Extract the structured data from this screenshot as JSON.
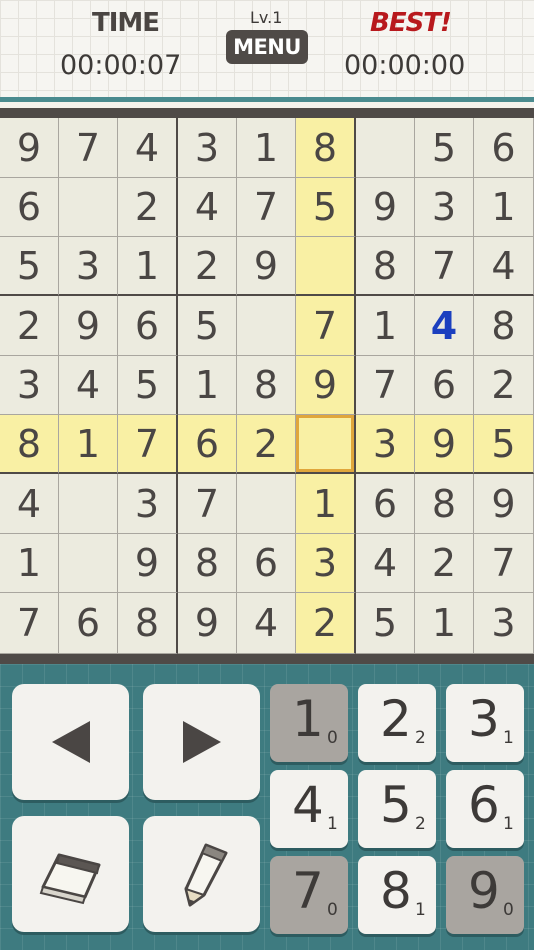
{
  "header": {
    "time_label": "TIME",
    "time_value": "00:00:07",
    "level_label": "Lv.1",
    "menu_label": "MENU",
    "best_label": "BEST!",
    "best_value": "00:00:00"
  },
  "board": {
    "selected": {
      "row": 5,
      "col": 5
    },
    "highlight_color": "#f9f0a4",
    "user_entry_color": "#1b3fbf",
    "rows": [
      [
        "9",
        "7",
        "4",
        "3",
        "1",
        "8",
        "",
        "5",
        "6"
      ],
      [
        "6",
        "",
        "2",
        "4",
        "7",
        "5",
        "9",
        "3",
        "1"
      ],
      [
        "5",
        "3",
        "1",
        "2",
        "9",
        "",
        "8",
        "7",
        "4"
      ],
      [
        "2",
        "9",
        "6",
        "5",
        "",
        "7",
        "1",
        "4",
        "8"
      ],
      [
        "3",
        "4",
        "5",
        "1",
        "8",
        "9",
        "7",
        "6",
        "2"
      ],
      [
        "8",
        "1",
        "7",
        "6",
        "2",
        "",
        "3",
        "9",
        "5"
      ],
      [
        "4",
        "",
        "3",
        "7",
        "",
        "1",
        "6",
        "8",
        "9"
      ],
      [
        "1",
        "",
        "9",
        "8",
        "6",
        "3",
        "4",
        "2",
        "7"
      ],
      [
        "7",
        "6",
        "8",
        "9",
        "4",
        "2",
        "5",
        "1",
        "3"
      ]
    ],
    "user_entries": [
      {
        "row": 3,
        "col": 7
      }
    ]
  },
  "controls": {
    "left_arrow_icon": "left-arrow-icon",
    "right_arrow_icon": "right-arrow-icon",
    "eraser_icon": "eraser-icon",
    "pencil_icon": "pencil-icon",
    "number_buttons": [
      {
        "digit": "1",
        "remaining": "0",
        "used": true
      },
      {
        "digit": "2",
        "remaining": "2",
        "used": false
      },
      {
        "digit": "3",
        "remaining": "1",
        "used": false
      },
      {
        "digit": "4",
        "remaining": "1",
        "used": false
      },
      {
        "digit": "5",
        "remaining": "2",
        "used": false
      },
      {
        "digit": "6",
        "remaining": "1",
        "used": false
      },
      {
        "digit": "7",
        "remaining": "0",
        "used": true
      },
      {
        "digit": "8",
        "remaining": "1",
        "used": false
      },
      {
        "digit": "9",
        "remaining": "0",
        "used": true
      }
    ]
  }
}
